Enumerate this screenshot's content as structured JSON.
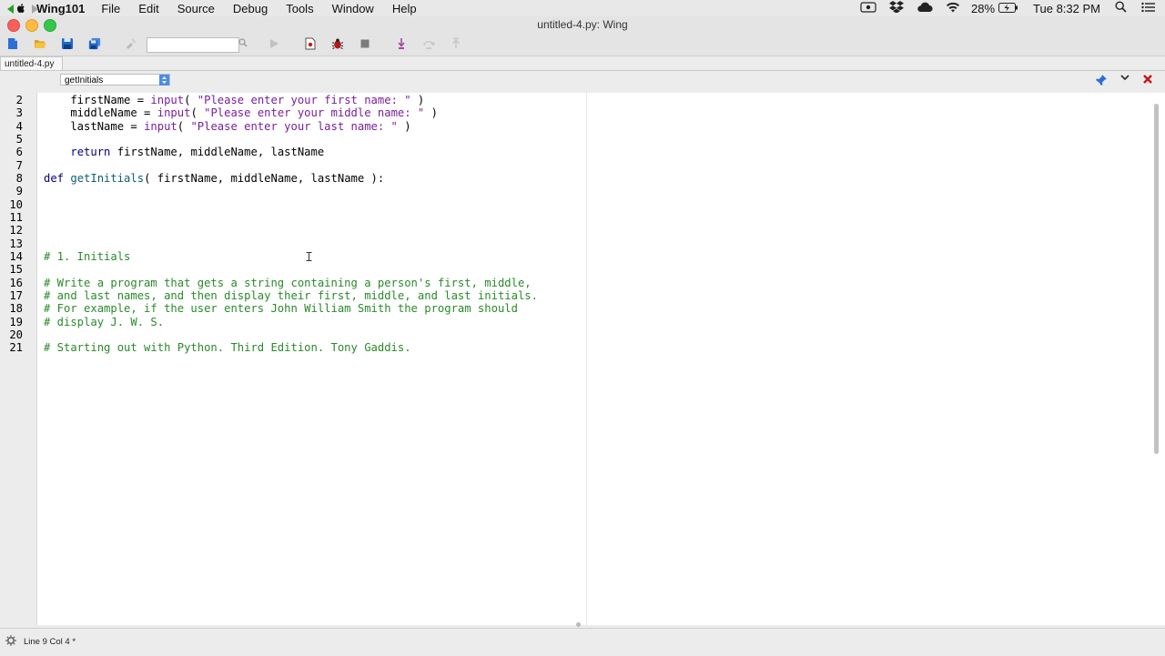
{
  "menubar": {
    "app_name": "Wing101",
    "items": [
      "File",
      "Edit",
      "Source",
      "Debug",
      "Tools",
      "Window",
      "Help"
    ],
    "battery": "28%",
    "clock": "Tue 8:32 PM"
  },
  "window": {
    "title": "untitled-4.py: Wing"
  },
  "toolbar": {
    "search_value": ""
  },
  "tabs": [
    {
      "label": "untitled-4.py",
      "active": true
    }
  ],
  "navbar": {
    "scope": "getInitials"
  },
  "editor": {
    "lines": [
      {
        "n": "2",
        "text": "    firstName = input( \"Please enter your first name: \" )"
      },
      {
        "n": "3",
        "text": "    middleName = input( \"Please enter your middle name: \" )"
      },
      {
        "n": "4",
        "text": "    lastName = input( \"Please enter your last name: \" )"
      },
      {
        "n": "5",
        "text": ""
      },
      {
        "n": "6",
        "text": "    return firstName, middleName, lastName"
      },
      {
        "n": "7",
        "text": ""
      },
      {
        "n": "8",
        "text": "def getInitials( firstName, middleName, lastName ):"
      },
      {
        "n": "9",
        "text": ""
      },
      {
        "n": "10",
        "text": ""
      },
      {
        "n": "11",
        "text": ""
      },
      {
        "n": "12",
        "text": ""
      },
      {
        "n": "13",
        "text": ""
      },
      {
        "n": "14",
        "text": "# 1. Initials"
      },
      {
        "n": "15",
        "text": ""
      },
      {
        "n": "16",
        "text": "# Write a program that gets a string containing a person's first, middle,"
      },
      {
        "n": "17",
        "text": "# and last names, and then display their first, middle, and last initials."
      },
      {
        "n": "18",
        "text": "# For example, if the user enters John William Smith the program should"
      },
      {
        "n": "19",
        "text": "# display J. W. S."
      },
      {
        "n": "20",
        "text": ""
      },
      {
        "n": "21",
        "text": "# Starting out with Python. Third Edition. Tony Gaddis."
      }
    ]
  },
  "status": {
    "text": "Line 9 Col 4 *"
  },
  "colors": {
    "keyword": "#000080",
    "string": "#7a1f9b",
    "function": "#0a5f6e",
    "comment": "#2a8a2a"
  }
}
